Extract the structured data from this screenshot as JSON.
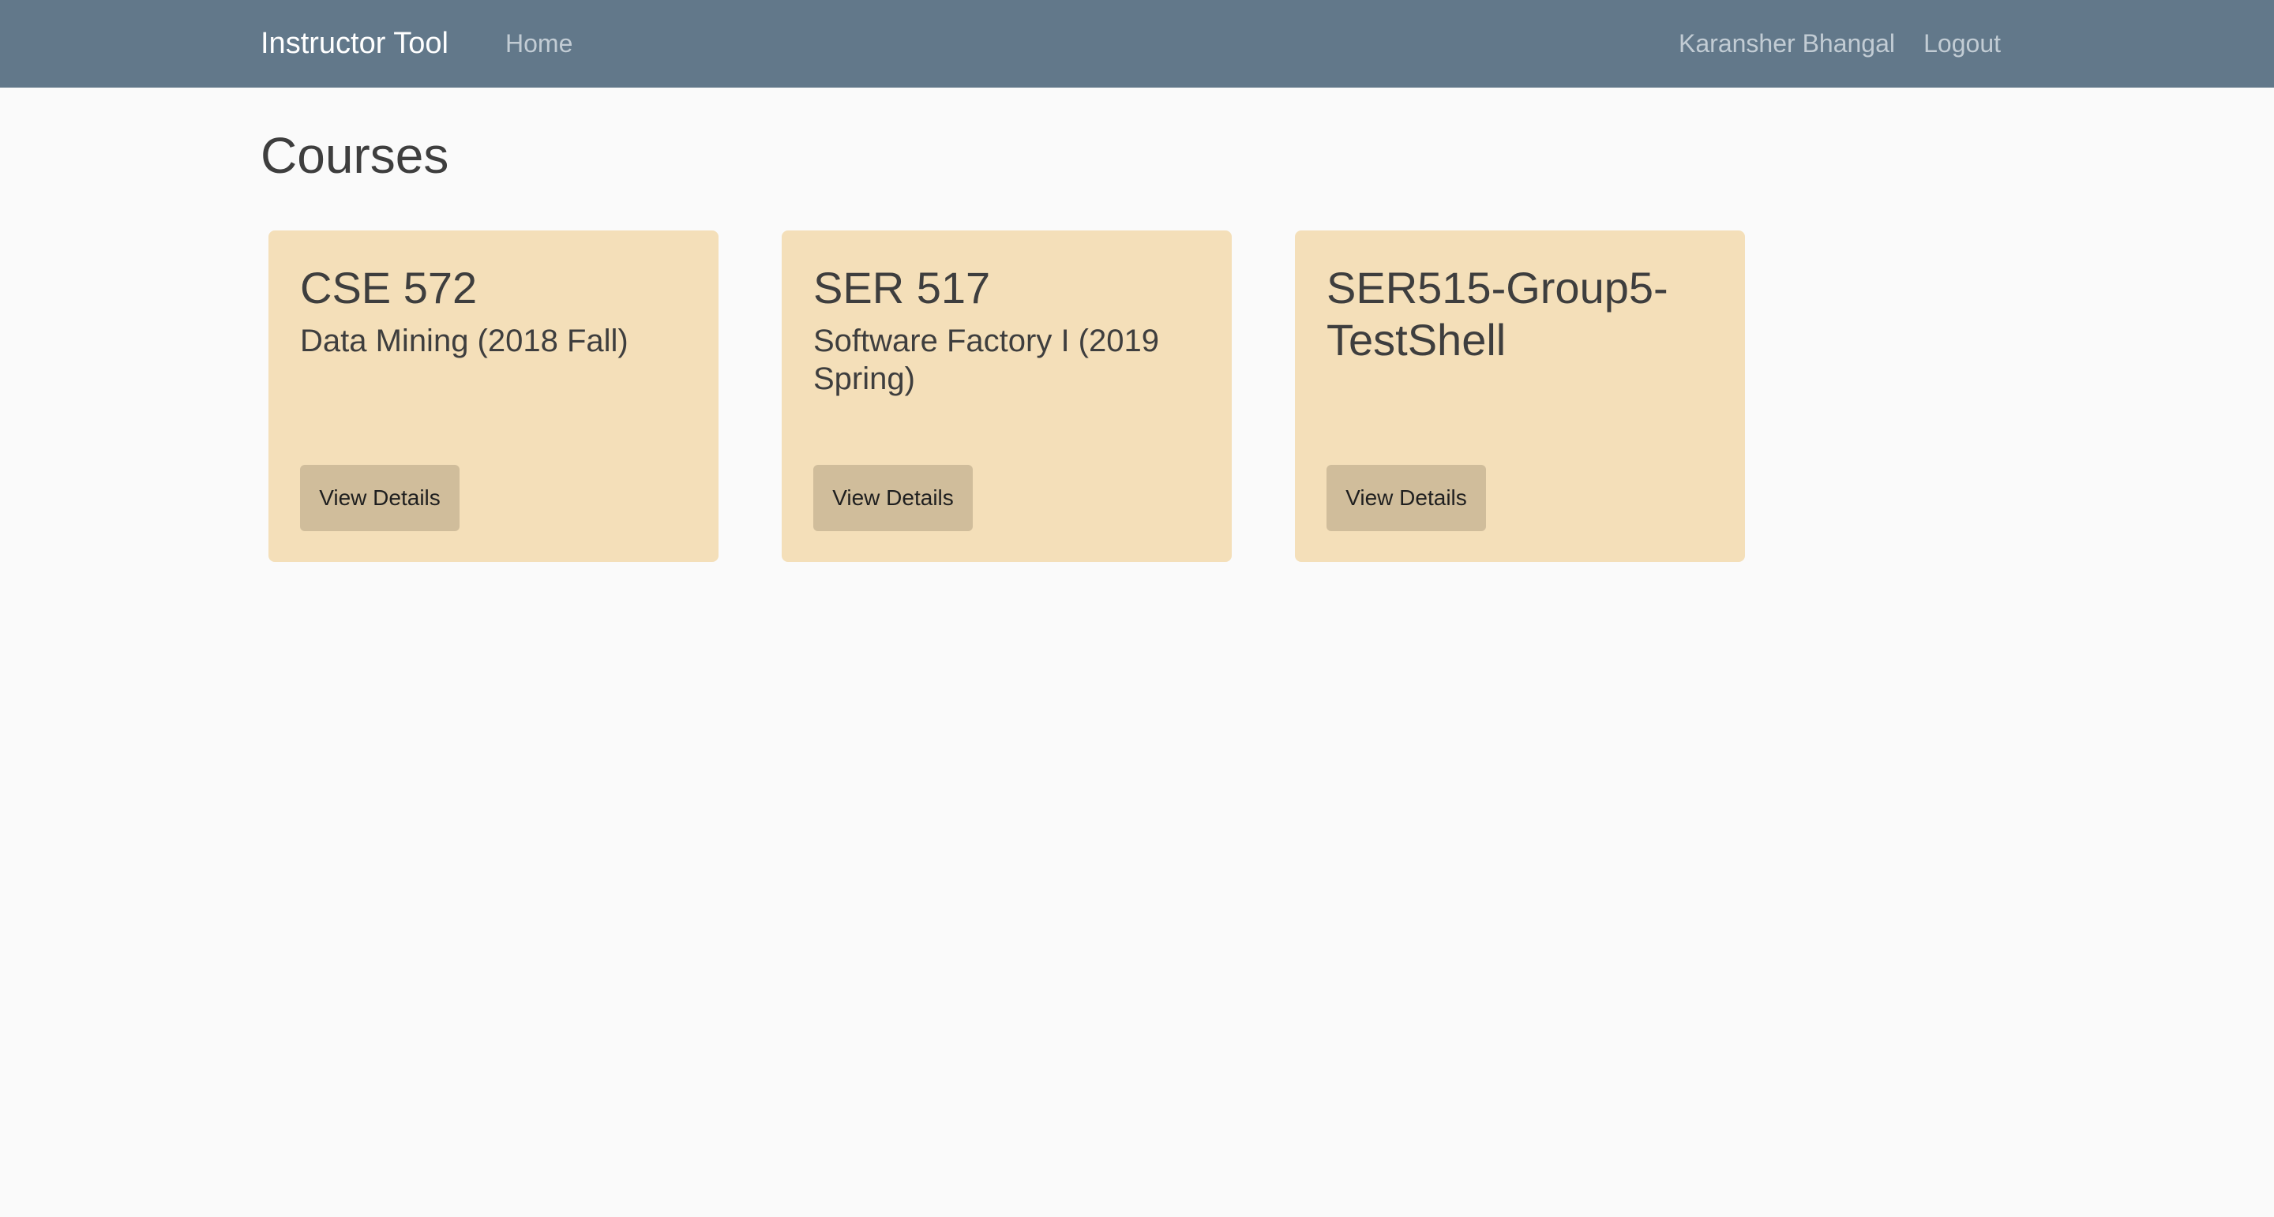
{
  "navbar": {
    "brand": "Instructor Tool",
    "home": "Home",
    "user_name": "Karansher Bhangal",
    "logout": "Logout"
  },
  "page": {
    "title": "Courses"
  },
  "courses": [
    {
      "code": "CSE 572",
      "name": "Data Mining (2018 Fall)",
      "button_label": "View Details"
    },
    {
      "code": "SER 517",
      "name": "Software Factory I (2019 Spring)",
      "button_label": "View Details"
    },
    {
      "code": "SER515-Group5-TestShell",
      "name": "",
      "button_label": "View Details"
    }
  ],
  "colors": {
    "navbar_bg": "#62788a",
    "card_bg": "#f4dfb9",
    "button_bg": "#d0bd9b",
    "page_bg": "#fafafa"
  }
}
